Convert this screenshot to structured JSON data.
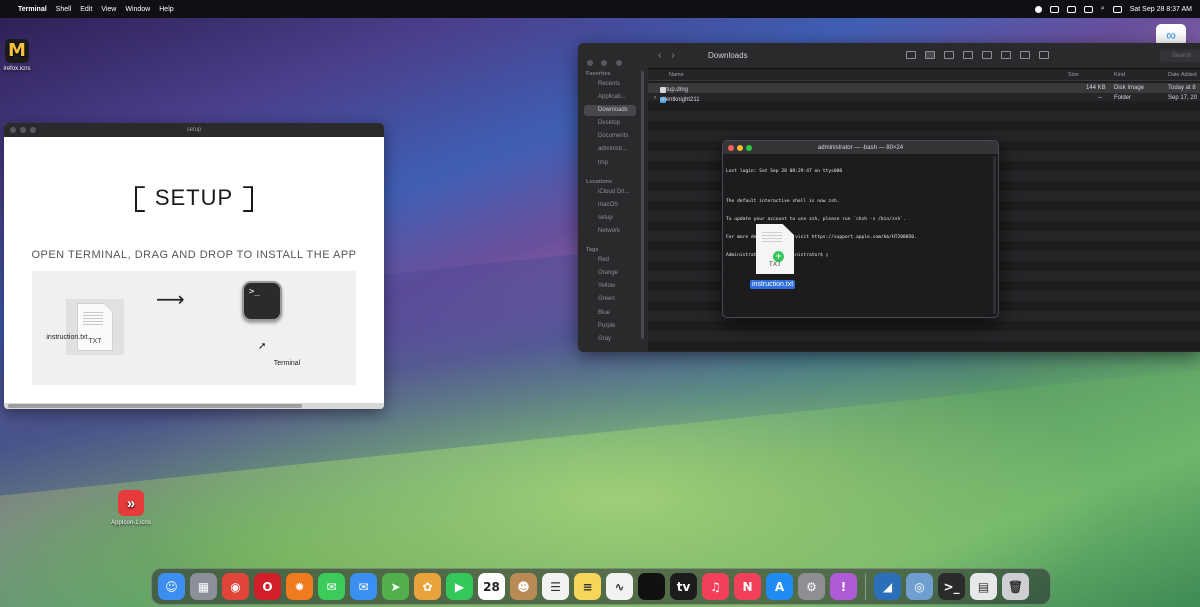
{
  "menubar": {
    "app_name": "Terminal",
    "menus": [
      "Shell",
      "Edit",
      "View",
      "Window",
      "Help"
    ],
    "clock": "Sat Sep 28  8:37 AM"
  },
  "desktop": {
    "top_icon_label": "irefox.icns",
    "bottom_icon_label": "AppIcon-1.icns"
  },
  "setup_window": {
    "title": "setup",
    "heading": "SETUP",
    "subheading": "OPEN TERMINAL, DRAG AND DROP TO INSTALL THE APP",
    "file_type": "TXT",
    "file_name": "instruction.txt",
    "arrow": "⟶",
    "terminal_glyph": ">_",
    "terminal_name": "Terminal"
  },
  "finder": {
    "title": "Downloads",
    "search_placeholder": "Search",
    "sidebar": {
      "favorites_header": "Favorites",
      "favorites": [
        "Recents",
        "Applicati...",
        "Downloads",
        "Desktop",
        "Documents",
        "administr...",
        "tmp"
      ],
      "locations_header": "Locations",
      "locations": [
        "iCloud Dri...",
        "macOS",
        "setup",
        "Network"
      ],
      "tags_header": "Tags",
      "tags": [
        "Red",
        "Orange",
        "Yellow",
        "Green",
        "Blue",
        "Purple",
        "Gray"
      ]
    },
    "columns": {
      "name": "Name",
      "size": "Size",
      "kind": "Kind",
      "date": "Date Added"
    },
    "rows": [
      {
        "name": "setup.dmg",
        "size": "144 KB",
        "kind": "Disk Image",
        "date": "Today at 8"
      },
      {
        "name": "silentknight211",
        "size": "--",
        "kind": "Folder",
        "date": "Sep 17, 20"
      }
    ]
  },
  "terminal": {
    "title": "administrator — -bash — 80×24",
    "lines": [
      "Last login: Sat Sep 28 08:29:47 on ttys000",
      "",
      "The default interactive shell is now zsh.",
      "To update your account to use zsh, please run `chsh -s /bin/zsh`.",
      "For more details, please visit https://support.apple.com/kb/HT208050.",
      "Administrators-Mac:~ administrator$ ▯"
    ],
    "dragged_file_type": "TXT",
    "dragged_file_name": "instruction.txt",
    "plus": "+"
  },
  "dock": {
    "apps": [
      {
        "name": "finder",
        "glyph": "☺",
        "color": "#3d8ef0"
      },
      {
        "name": "launchpad",
        "glyph": "▦",
        "color": "#8a8f99"
      },
      {
        "name": "chrome",
        "glyph": "◉",
        "color": "#e0453a"
      },
      {
        "name": "opera",
        "glyph": "O",
        "color": "#d21f2a"
      },
      {
        "name": "firefox",
        "glyph": "✹",
        "color": "#f07a1e"
      },
      {
        "name": "messages",
        "glyph": "✉",
        "color": "#3ccb5a"
      },
      {
        "name": "mail",
        "glyph": "✉",
        "color": "#3b8ff0"
      },
      {
        "name": "maps",
        "glyph": "➤",
        "color": "#52b04a"
      },
      {
        "name": "photos",
        "glyph": "✿",
        "color": "#e8a33d"
      },
      {
        "name": "facetime",
        "glyph": "▶",
        "color": "#34c759"
      },
      {
        "name": "calendar",
        "glyph": "28",
        "color": "#ffffff"
      },
      {
        "name": "contacts",
        "glyph": "☻",
        "color": "#b88a55"
      },
      {
        "name": "reminders",
        "glyph": "☰",
        "color": "#f2f2f2"
      },
      {
        "name": "notes",
        "glyph": "≡",
        "color": "#f6d65a"
      },
      {
        "name": "freeform",
        "glyph": "∿",
        "color": "#f2f2f2"
      },
      {
        "name": "black-app",
        "glyph": "",
        "color": "#111111"
      },
      {
        "name": "apple-tv",
        "glyph": "tv",
        "color": "#1c1c1e"
      },
      {
        "name": "music",
        "glyph": "♫",
        "color": "#f2405a"
      },
      {
        "name": "news",
        "glyph": "N",
        "color": "#f2405a"
      },
      {
        "name": "app-store",
        "glyph": "A",
        "color": "#1f8bf3"
      },
      {
        "name": "system-settings",
        "glyph": "⚙",
        "color": "#8e8e93"
      },
      {
        "name": "feedback",
        "glyph": "!",
        "color": "#b05bd6"
      },
      {
        "name": "shark-app",
        "glyph": "◢",
        "color": "#2a6fb8"
      },
      {
        "name": "preview",
        "glyph": "◎",
        "color": "#6f9fcf"
      },
      {
        "name": "terminal",
        "glyph": ">_",
        "color": "#2b2b2b"
      },
      {
        "name": "downloads-stack",
        "glyph": "▤",
        "color": "#e8e8ea"
      },
      {
        "name": "trash",
        "glyph": "🗑",
        "color": "#cfcfd3"
      }
    ]
  }
}
